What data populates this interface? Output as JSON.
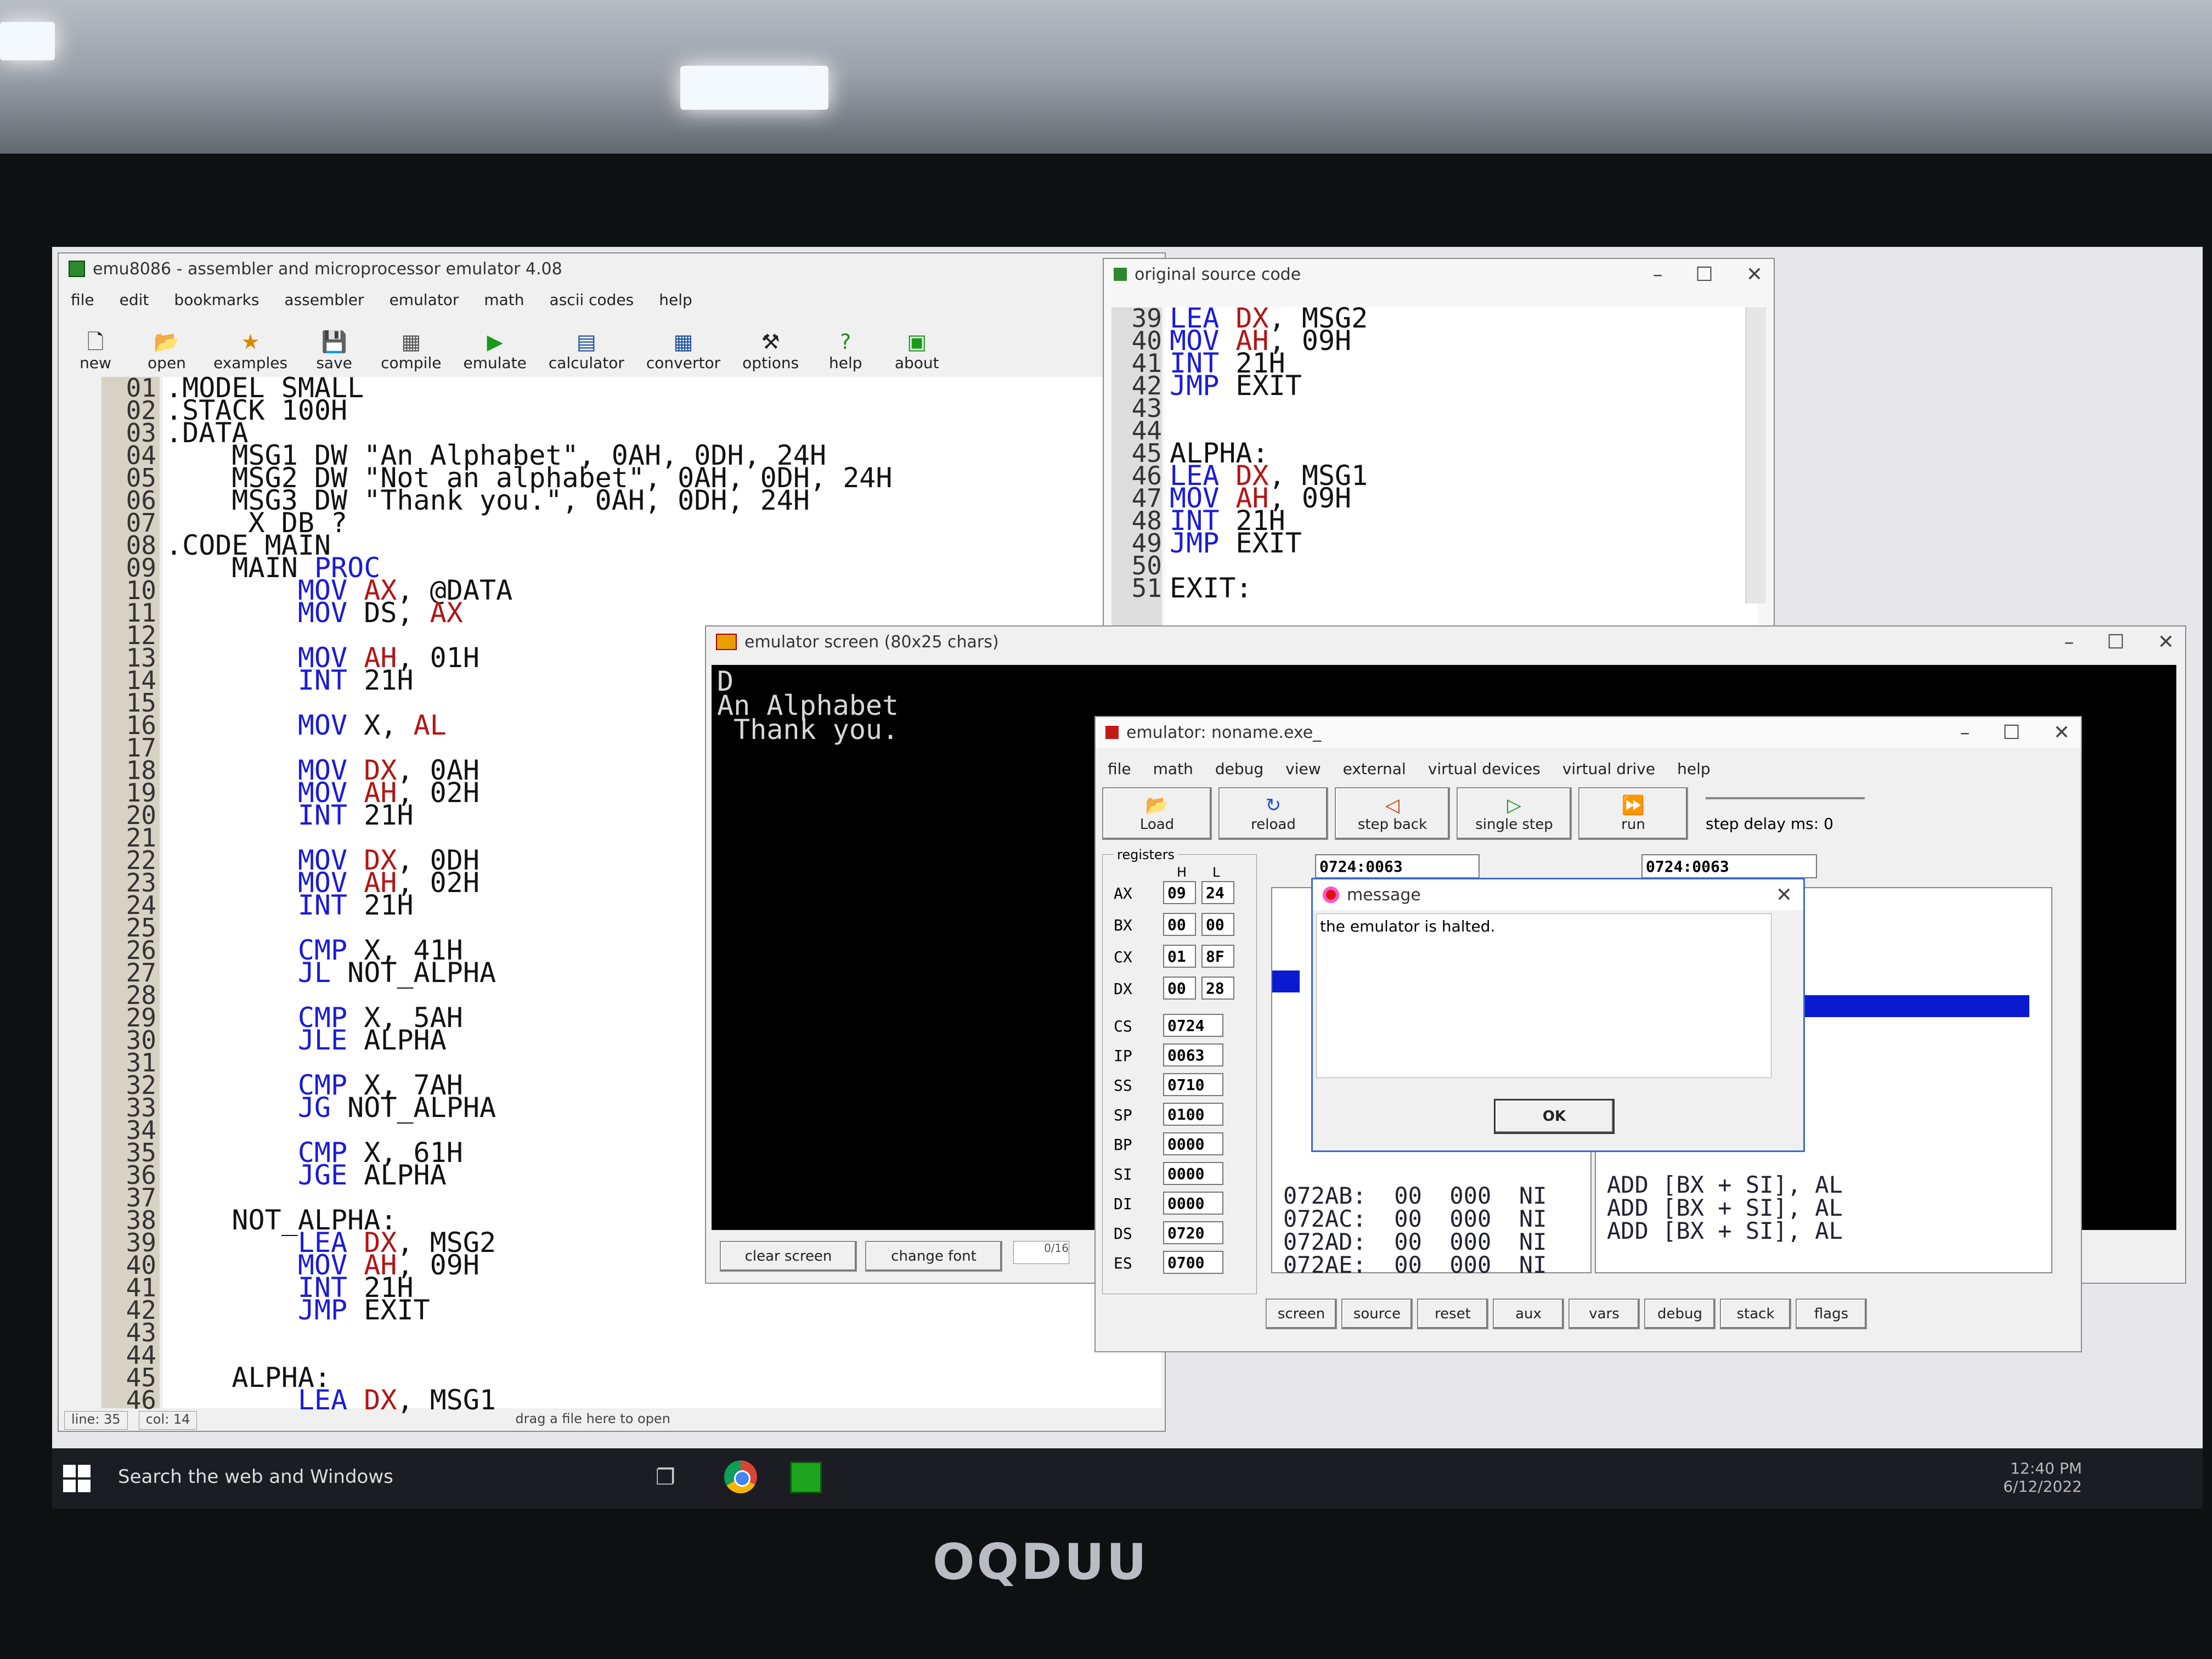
{
  "brand": "OQDUU",
  "editor": {
    "title": "emu8086 - assembler and microprocessor emulator 4.08",
    "menu": [
      "file",
      "edit",
      "bookmarks",
      "assembler",
      "emulator",
      "math",
      "ascii codes",
      "help"
    ],
    "toolbar": [
      {
        "label": "new",
        "icon": "🗋"
      },
      {
        "label": "open",
        "icon": "📂"
      },
      {
        "label": "examples",
        "icon": "★"
      },
      {
        "label": "save",
        "icon": "💾"
      },
      {
        "label": "compile",
        "icon": "▦"
      },
      {
        "label": "emulate",
        "icon": "▶"
      },
      {
        "label": "calculator",
        "icon": "▤"
      },
      {
        "label": "convertor",
        "icon": "▦"
      },
      {
        "label": "options",
        "icon": "⚒"
      },
      {
        "label": "help",
        "icon": "?"
      },
      {
        "label": "about",
        "icon": "▣"
      }
    ],
    "line_numbers": [
      "01",
      "02",
      "03",
      "04",
      "05",
      "06",
      "07",
      "08",
      "09",
      "10",
      "11",
      "12",
      "13",
      "14",
      "15",
      "16",
      "17",
      "18",
      "19",
      "20",
      "21",
      "22",
      "23",
      "24",
      "25",
      "26",
      "27",
      "28",
      "29",
      "30",
      "31",
      "32",
      "33",
      "34",
      "35",
      "36",
      "37",
      "38",
      "39",
      "40",
      "41",
      "42",
      "43",
      "44",
      "45",
      "46"
    ],
    "status_line": "line: 35",
    "status_col": "col: 14",
    "status_drag": "drag a file here to open"
  },
  "source": {
    "title": "original source code",
    "line_numbers": [
      "39",
      "40",
      "41",
      "42",
      "43",
      "44",
      "45",
      "46",
      "47",
      "48",
      "49",
      "50",
      "51"
    ]
  },
  "screen": {
    "title": "emulator screen (80x25 chars)",
    "lines": [
      "D",
      "An Alphabet",
      " Thank you."
    ],
    "clear_label": "clear screen",
    "font_label": "change font",
    "small_box": "0/16"
  },
  "emulator": {
    "title": "emulator: noname.exe_",
    "menu": [
      "file",
      "math",
      "debug",
      "view",
      "external",
      "virtual devices",
      "virtual drive",
      "help"
    ],
    "toolbar": [
      {
        "label": "Load",
        "icon": "📂"
      },
      {
        "label": "reload",
        "icon": "↻"
      },
      {
        "label": "step back",
        "icon": "◁"
      },
      {
        "label": "single step",
        "icon": "▷"
      },
      {
        "label": "run",
        "icon": "⏩"
      }
    ],
    "step_delay": "step delay ms: 0",
    "registers_label": "registers",
    "h_label": "H",
    "l_label": "L",
    "regs_hl": [
      {
        "name": "AX",
        "h": "09",
        "l": "24"
      },
      {
        "name": "BX",
        "h": "00",
        "l": "00"
      },
      {
        "name": "CX",
        "h": "01",
        "l": "8F"
      },
      {
        "name": "DX",
        "h": "00",
        "l": "28"
      }
    ],
    "regs": [
      {
        "name": "CS",
        "v": "0724"
      },
      {
        "name": "IP",
        "v": "0063"
      },
      {
        "name": "SS",
        "v": "0710"
      },
      {
        "name": "SP",
        "v": "0100"
      },
      {
        "name": "BP",
        "v": "0000"
      },
      {
        "name": "SI",
        "v": "0000"
      },
      {
        "name": "DI",
        "v": "0000"
      },
      {
        "name": "DS",
        "v": "0720"
      },
      {
        "name": "ES",
        "v": "0700"
      }
    ],
    "addr1": "0724:0063",
    "addr2": "0724:0063",
    "mem_rows": [
      "072AB:  00  000  NI",
      "072AC:  00  000  NI",
      "072AD:  00  000  NI",
      "072AE:  00  000  NI"
    ],
    "disasm_rows": [
      "ADD [BX + SI], AL",
      "ADD [BX + SI], AL",
      "ADD [BX + SI], AL"
    ],
    "bottom_tabs": [
      "screen",
      "source",
      "reset",
      "aux",
      "vars",
      "debug",
      "stack",
      "flags"
    ]
  },
  "message": {
    "title": "message",
    "text": "the emulator is halted.",
    "ok": "OK"
  },
  "taskbar": {
    "search": "Search the web and Windows",
    "time": "12:40 PM",
    "date": "6/12/2022"
  }
}
